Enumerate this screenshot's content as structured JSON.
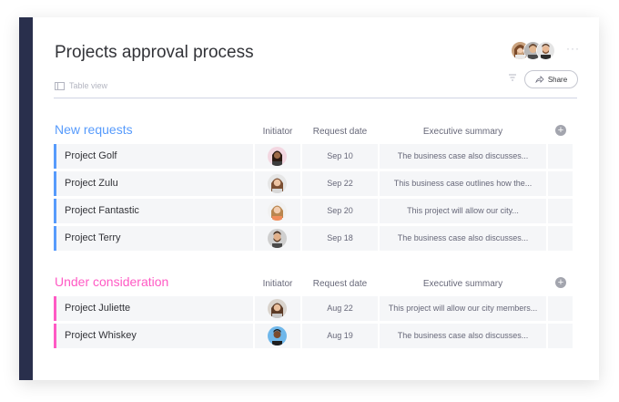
{
  "board": {
    "title": "Projects approval process",
    "view_label": "Table view",
    "share_label": "Share",
    "more_label": "···"
  },
  "colors": {
    "sidebar": "#292f4c",
    "new_requests": "#579bfc",
    "under_consideration": "#ff5ac4"
  },
  "groups": [
    {
      "title": "New requests",
      "color": "#579bfc",
      "columns": {
        "initiator": "Initiator",
        "date": "Request date",
        "summary": "Executive summary"
      },
      "rows": [
        {
          "name": "Project Golf",
          "date": "Sep 10",
          "summary": "The business case also discusses..."
        },
        {
          "name": "Project Zulu",
          "date": "Sep 22",
          "summary": "This business case outlines how the..."
        },
        {
          "name": "Project Fantastic",
          "date": "Sep 20",
          "summary": "This project will allow our city..."
        },
        {
          "name": "Project Terry",
          "date": "Sep 18",
          "summary": "The business case also discusses..."
        }
      ]
    },
    {
      "title": "Under consideration",
      "color": "#ff5ac4",
      "columns": {
        "initiator": "Initiator",
        "date": "Request date",
        "summary": "Executive summary"
      },
      "rows": [
        {
          "name": "Project Juliette",
          "date": "Aug 22",
          "summary": "This project will allow our city members..."
        },
        {
          "name": "Project Whiskey",
          "date": "Aug 19",
          "summary": "The business case also discusses..."
        }
      ]
    }
  ]
}
